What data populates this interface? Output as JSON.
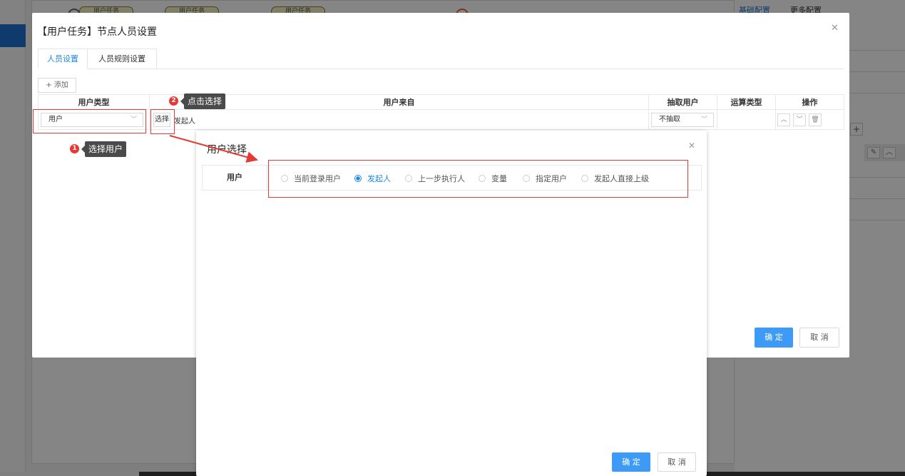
{
  "background": {
    "nodes": [
      "用户任务",
      "用户任务",
      "用户任务"
    ],
    "tab_basic": "基础配置",
    "tab_more": "更多配置"
  },
  "main_dialog": {
    "title": "【用户任务】节点人员设置",
    "tabs": [
      {
        "label": "人员设置",
        "active": true
      },
      {
        "label": "人员规则设置",
        "active": false
      }
    ],
    "add_button": "+ 添加",
    "columns": [
      "用户类型",
      "用户来自",
      "抽取用户",
      "运算类型",
      "操作"
    ],
    "row": {
      "user_type": "用户",
      "select_button": "选择",
      "user_from": "发起人",
      "extract": "不抽取",
      "op_type": ""
    },
    "confirm": "确 定",
    "cancel": "取 消"
  },
  "annotations": {
    "step1_number": "1",
    "step1_text": "选择用户",
    "step2_number": "2",
    "step2_text": "点击选择"
  },
  "user_dialog": {
    "title": "用户选择",
    "field_label": "用户",
    "options": [
      {
        "label": "当前登录用户",
        "checked": false
      },
      {
        "label": "发起人",
        "checked": true
      },
      {
        "label": "上一步执行人",
        "checked": false
      },
      {
        "label": "变量",
        "checked": false
      },
      {
        "label": "指定用户",
        "checked": false
      },
      {
        "label": "发起人直接上级",
        "checked": false
      }
    ],
    "confirm": "确 定",
    "cancel": "取 消"
  },
  "colors": {
    "accent": "#1e88e5",
    "primary_button": "#3d9bf5",
    "annotation_red": "#e53935"
  }
}
